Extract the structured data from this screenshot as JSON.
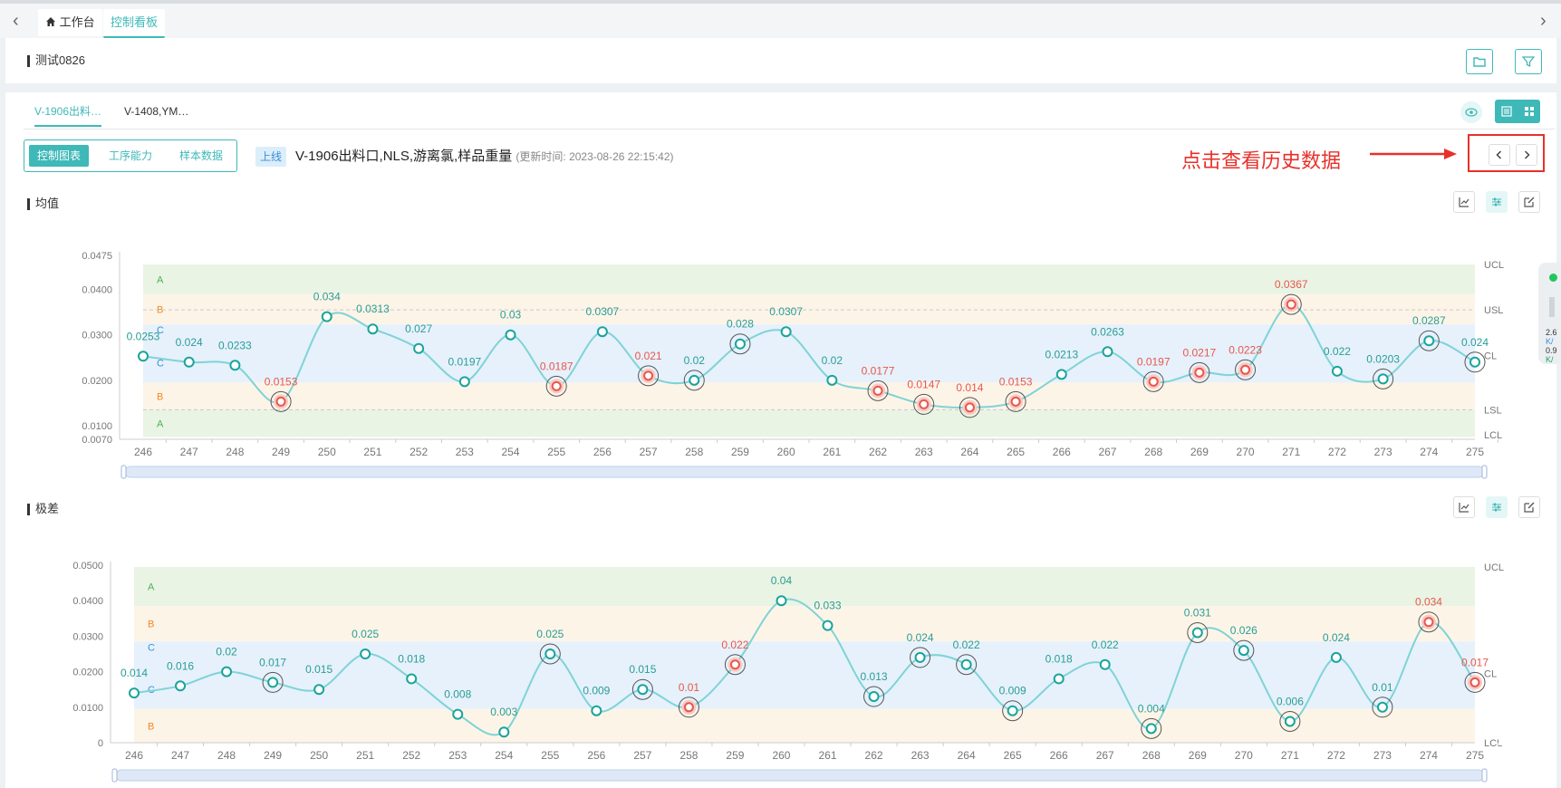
{
  "nav": {
    "back": "‹",
    "forward": "›"
  },
  "tabs": [
    {
      "label": "工作台",
      "icon": "home-icon"
    },
    {
      "label": "控制看板"
    }
  ],
  "header": {
    "title": "测试0826"
  },
  "subtabs": [
    "V-1906出料…",
    "V-1408,YM…"
  ],
  "segments": [
    "控制图表",
    "工序能力",
    "样本数据"
  ],
  "badge": "上线",
  "chart_title": "V-1906出料口,NLS,游离氯,样品重量",
  "update_time": "(更新时间: 2023-08-26 22:15:42)",
  "annotation": "点击查看历史数据",
  "colors": {
    "accent": "#3fb8b8",
    "line": "#7fd3d6",
    "alarm": "#e8574c",
    "annotation": "#e8302a",
    "zoneA": "#e9f4e4",
    "zoneB": "#fdf4e8",
    "zoneC": "#e6f1fb"
  },
  "sections": {
    "mean": "均值",
    "range": "极差"
  },
  "side_widget": {
    "v1": "2.6",
    "v2": "K/",
    "v3": "0.9",
    "v4": "K/"
  },
  "chart_data": [
    {
      "type": "line",
      "title": "均值",
      "x": [
        "246",
        "247",
        "248",
        "249",
        "250",
        "251",
        "252",
        "253",
        "254",
        "255",
        "256",
        "257",
        "258",
        "259",
        "260",
        "261",
        "262",
        "263",
        "264",
        "265",
        "266",
        "267",
        "268",
        "269",
        "270",
        "271",
        "272",
        "273",
        "274",
        "275"
      ],
      "values": [
        0.0253,
        0.024,
        0.0233,
        0.0153,
        0.034,
        0.0313,
        0.027,
        0.0197,
        0.03,
        0.0187,
        0.0307,
        0.021,
        0.02,
        0.028,
        0.0307,
        0.02,
        0.0177,
        0.0147,
        0.014,
        0.0153,
        0.0213,
        0.0263,
        0.0197,
        0.0217,
        0.0223,
        0.0367,
        0.022,
        0.0203,
        0.0287,
        0.024
      ],
      "value_labels": [
        "0.0253",
        "0.024",
        "0.0233",
        "0.0153",
        "0.034",
        "0.0313",
        "0.027",
        "0.0197",
        "0.03",
        "0.0187",
        "0.0307",
        "0.021",
        "0.02",
        "0.028",
        "0.0307",
        "0.02",
        "0.0177",
        "0.0147",
        "0.014",
        "0.0153",
        "0.0213",
        "0.0263",
        "0.0197",
        "0.0217",
        "0.0223",
        "0.0367",
        "0.022",
        "0.0203",
        "0.0287",
        "0.024"
      ],
      "alarm": [
        false,
        false,
        false,
        true,
        false,
        false,
        false,
        false,
        false,
        true,
        false,
        true,
        false,
        false,
        false,
        false,
        true,
        true,
        true,
        true,
        false,
        false,
        true,
        true,
        true,
        true,
        false,
        false,
        false,
        false
      ],
      "circled": [
        false,
        false,
        false,
        true,
        false,
        false,
        false,
        false,
        false,
        true,
        false,
        true,
        true,
        true,
        false,
        false,
        true,
        true,
        true,
        true,
        false,
        false,
        true,
        true,
        true,
        true,
        false,
        true,
        true,
        true
      ],
      "yticks": [
        0.0475,
        0.04,
        0.03,
        0.02,
        0.01,
        0.007
      ],
      "ytick_labels": [
        "0.0475",
        "0.0400",
        "0.0300",
        "0.0200",
        "0.0100",
        "0.0070"
      ],
      "ylim": [
        0.007,
        0.0475
      ],
      "limits": {
        "UCL": 0.0455,
        "USL": 0.0355,
        "CL": 0.0255,
        "LSL": 0.0135,
        "LCL": 0.008
      },
      "zones": {
        "a_top": 0.0455,
        "b_top": 0.039,
        "c_top": 0.0323,
        "c_bottom": 0.0195,
        "b_bottom": 0.0135,
        "a_bottom": 0.0075
      },
      "zone_labels": [
        "A",
        "B",
        "C",
        "C",
        "B",
        "A"
      ]
    },
    {
      "type": "line",
      "title": "极差",
      "x": [
        "246",
        "247",
        "248",
        "249",
        "250",
        "251",
        "252",
        "253",
        "254",
        "255",
        "256",
        "257",
        "258",
        "259",
        "260",
        "261",
        "262",
        "263",
        "264",
        "265",
        "266",
        "267",
        "268",
        "269",
        "270",
        "271",
        "272",
        "273",
        "274",
        "275"
      ],
      "values": [
        0.014,
        0.016,
        0.02,
        0.017,
        0.015,
        0.025,
        0.018,
        0.008,
        0.003,
        0.025,
        0.009,
        0.015,
        0.01,
        0.022,
        0.04,
        0.033,
        0.013,
        0.024,
        0.022,
        0.009,
        0.018,
        0.022,
        0.004,
        0.031,
        0.026,
        0.006,
        0.024,
        0.01,
        0.034,
        0.017
      ],
      "value_labels": [
        "0.014",
        "0.016",
        "0.02",
        "0.017",
        "0.015",
        "0.025",
        "0.018",
        "0.008",
        "0.003",
        "0.025",
        "0.009",
        "0.015",
        "0.01",
        "0.022",
        "0.04",
        "0.033",
        "0.013",
        "0.024",
        "0.022",
        "0.009",
        "0.018",
        "0.022",
        "0.004",
        "0.031",
        "0.026",
        "0.006",
        "0.024",
        "0.01",
        "0.034",
        "0.017"
      ],
      "alarm": [
        false,
        false,
        false,
        false,
        false,
        false,
        false,
        false,
        false,
        false,
        false,
        false,
        true,
        true,
        false,
        false,
        false,
        false,
        false,
        false,
        false,
        false,
        false,
        false,
        false,
        false,
        false,
        false,
        true,
        true
      ],
      "circled": [
        false,
        false,
        false,
        true,
        false,
        false,
        false,
        false,
        false,
        true,
        false,
        true,
        true,
        true,
        false,
        false,
        true,
        true,
        true,
        true,
        false,
        false,
        true,
        true,
        true,
        true,
        false,
        true,
        true,
        true
      ],
      "yticks": [
        0.05,
        0.04,
        0.03,
        0.02,
        0.01,
        0
      ],
      "ytick_labels": [
        "0.0500",
        "0.0400",
        "0.0300",
        "0.0200",
        "0.0100",
        "0"
      ],
      "ylim": [
        0,
        0.05
      ],
      "limits": {
        "UCL": 0.0495,
        "CL": 0.0195,
        "LCL": 0.0
      },
      "zones": {
        "a_top": 0.0495,
        "b_top": 0.0385,
        "c_top": 0.0285,
        "c_bottom": 0.0095,
        "b_bottom": 0.0
      },
      "zone_labels": [
        "A",
        "B",
        "C",
        "C",
        "B"
      ]
    }
  ]
}
